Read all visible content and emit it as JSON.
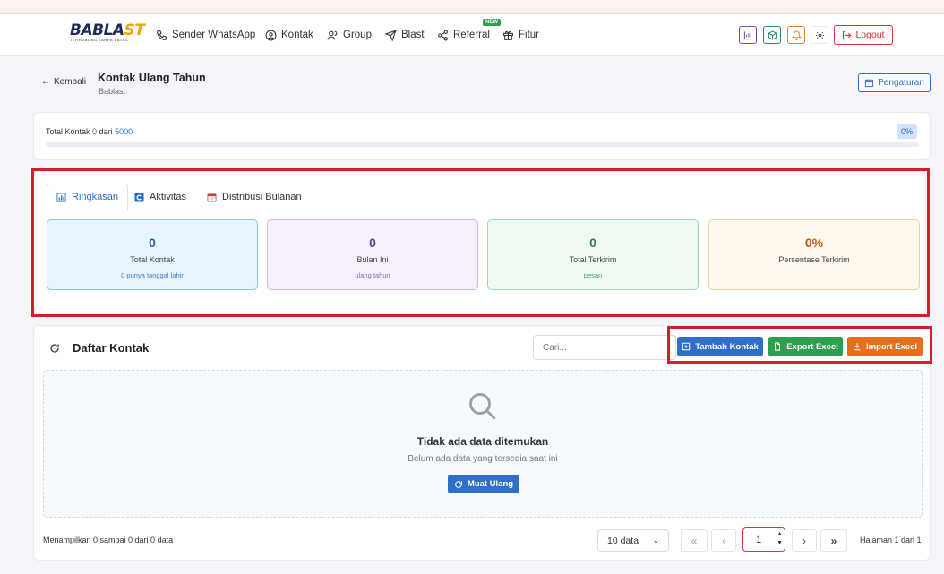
{
  "nav": {
    "brand_main": "BABLA",
    "brand_accent": "ST",
    "brand_tagline": "TERHUBUNG TANPA BATAS",
    "items": [
      {
        "label": "Sender WhatsApp",
        "icon": "phone-icon"
      },
      {
        "label": "Kontak",
        "icon": "user-circle-icon"
      },
      {
        "label": "Group",
        "icon": "users-icon"
      },
      {
        "label": "Blast",
        "icon": "send-icon"
      },
      {
        "label": "Referral",
        "icon": "share-icon"
      },
      {
        "label": "Fitur",
        "icon": "gift-icon"
      }
    ],
    "new_badge": "NEW",
    "logout_label": "Logout",
    "icons": [
      "chart-icon",
      "box-icon",
      "bell-icon",
      "gear-icon"
    ]
  },
  "header": {
    "back_label": "Kembali",
    "title": "Kontak Ulang Tahun",
    "subtitle": "Bablast",
    "settings_label": "Pengaturan"
  },
  "total": {
    "label_prefix": "Total Kontak",
    "count": "0",
    "label_mid": "dari",
    "max": "5000",
    "percent_label": "0%",
    "progress_fraction": 0
  },
  "tabs": [
    {
      "label": "Ringkasan",
      "icon": "chart-icon",
      "active": true
    },
    {
      "label": "Aktivitas",
      "icon": "activity-icon",
      "active": false
    },
    {
      "label": "Distribusi Bulanan",
      "icon": "calendar-icon",
      "active": false
    }
  ],
  "stats": [
    {
      "value": "0",
      "label": "Total Kontak",
      "sub": "0 punya tanggal lahir",
      "color": "#2f5f9c",
      "bg": "#e8f4fc",
      "border": "#8ec7ea",
      "subcolor": "#3b7bc0"
    },
    {
      "value": "0",
      "label": "Bulan Ini",
      "sub": "ulang tahun",
      "color": "#5b3f8f",
      "bg": "#f7f0fb",
      "border": "#d2b5ea",
      "subcolor": "#8a64b5"
    },
    {
      "value": "0",
      "label": "Total Terkirim",
      "sub": "pesan",
      "color": "#2e7d45",
      "bg": "#eefaf1",
      "border": "#9ed9ae",
      "subcolor": "#3f9a5a"
    },
    {
      "value": "0%",
      "label": "Persentase Terkirim",
      "sub": "",
      "color": "#c45a12",
      "bg": "#fff8ee",
      "border": "#f1cf98",
      "subcolor": "#c45a12"
    }
  ],
  "list": {
    "title": "Daftar Kontak",
    "search_placeholder": "Cari...",
    "buttons": [
      {
        "label": "Tambah Kontak",
        "color": "#2f6fc7",
        "icon": "plus-square-icon"
      },
      {
        "label": "Export Excel",
        "color": "#2e9e4f",
        "icon": "file-icon"
      },
      {
        "label": "Import Excel",
        "color": "#e4701e",
        "icon": "download-icon"
      }
    ],
    "empty_title": "Tidak ada data ditemukan",
    "empty_sub": "Belum ada data yang tersedia saat ini",
    "reload_label": "Muat Ulang"
  },
  "pagination": {
    "showing": "Menampilkan 0 sampai 0 dari 0 data",
    "per_page": "10 data",
    "current_page": "1",
    "page_info": "Halaman 1 dari 1",
    "first": "«",
    "prev": "‹",
    "next": "›",
    "last": "»"
  }
}
